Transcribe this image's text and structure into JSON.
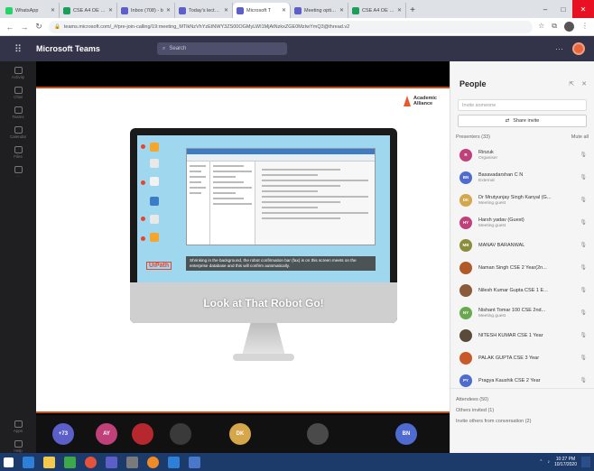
{
  "browser": {
    "tabs": [
      {
        "label": "WhatsApp",
        "fav_color": "#25d366",
        "active": false
      },
      {
        "label": "CSE A4 OE Rec",
        "fav_color": "#1a9e5a",
        "active": false
      },
      {
        "label": "Inbox (708) - b",
        "fav_color": "#5b5fc7",
        "active": false
      },
      {
        "label": "Today's lecture",
        "fav_color": "#5b5fc7",
        "active": false
      },
      {
        "label": "Microsoft T",
        "fav_color": "#5b5fc7",
        "active": true
      },
      {
        "label": "Meeting options",
        "fav_color": "#5b5fc7",
        "active": false
      },
      {
        "label": "CSE A4 OE Rec",
        "fav_color": "#1a9e5a",
        "active": false
      }
    ],
    "new_tab": "+",
    "url": "teams.microsoft.com/_#/pre-join-calling/19:meeting_MTlkNzVhYzEtNWY3ZS00OGMyLWI1MjAtNzkxZGE0MzIwYmQ3@thread.v2",
    "window_controls": {
      "minimize": "–",
      "maximize": "□",
      "close": "✕"
    }
  },
  "teams": {
    "app_name": "Microsoft Teams",
    "search_placeholder": "Search",
    "more": "···"
  },
  "rail": {
    "items": [
      {
        "label": "Activity",
        "icon": "bell-icon"
      },
      {
        "label": "Chat",
        "icon": "chat-icon"
      },
      {
        "label": "Teams",
        "icon": "teams-icon"
      },
      {
        "label": "Calendar",
        "icon": "calendar-icon"
      },
      {
        "label": "Files",
        "icon": "file-icon"
      },
      {
        "label": "···",
        "icon": "more-icon"
      }
    ],
    "bottom": [
      {
        "label": "Apps",
        "icon": "apps-icon"
      },
      {
        "label": "Help",
        "icon": "help-icon"
      }
    ]
  },
  "share": {
    "logo_line1": "Academic",
    "logo_line2": "Alliance",
    "subtitle": "Shrinking in the background, the robot confirmation bar (fax) is on this screen meets on the enterprise database and this will confirm automatically.",
    "brand": "UiPath",
    "caption": "Look at That Robot Go!"
  },
  "strip": {
    "participants": [
      {
        "initials": "+73",
        "color": "#5b5fc7"
      },
      {
        "initials": "AY",
        "color": "#c0407a"
      },
      {
        "initials": "",
        "color": "#b7282e"
      },
      {
        "initials": "",
        "color": "#3a3a3a"
      },
      {
        "initials": "DK",
        "color": "#d5a64a"
      },
      {
        "initials": "",
        "color": "#4a4a4a"
      },
      {
        "initials": "BN",
        "color": "#4f6bd0"
      }
    ]
  },
  "people": {
    "title": "People",
    "invite_placeholder": "Invite someone",
    "share_invite": "Share invite",
    "presenters_label": "Presenters (33)",
    "mute_all": "Mute all",
    "list": [
      {
        "initials": "R",
        "name": "Rinzuk",
        "role": "Organiser",
        "color": "#c0407a"
      },
      {
        "initials": "BN",
        "name": "Basavadarshan C N",
        "role": "External",
        "color": "#4f6bd0"
      },
      {
        "initials": "DK",
        "name": "Dr Mrutyunjay Singh Kanyal (G...",
        "role": "Meeting guest",
        "color": "#d5a64a"
      },
      {
        "initials": "HY",
        "name": "Harsh yadav (Guest)",
        "role": "Meeting guest",
        "color": "#c0407a"
      },
      {
        "initials": "MB",
        "name": "MANAV BARANWAL",
        "role": "",
        "color": "#8b8d3a"
      },
      {
        "initials": "",
        "name": "Naman Singh CSE 2 Year(2n...",
        "role": "",
        "color": "#b05a2a"
      },
      {
        "initials": "",
        "name": "Nilesh Kumar Gupta CSE 1 E...",
        "role": "",
        "color": "#8a5a3a"
      },
      {
        "initials": "NY",
        "name": "Nishant Tomar 100 CSE 2nd...",
        "role": "Meeting guest",
        "color": "#6aa84f"
      },
      {
        "initials": "",
        "name": "NITESH KUMAR CSE 1 Year",
        "role": "",
        "color": "#5a4a3a"
      },
      {
        "initials": "",
        "name": "PALAK GUPTA CSE 3 Year",
        "role": "",
        "color": "#c85a2a"
      },
      {
        "initials": "PY",
        "name": "Pragya Kaushik CSE 2 Year",
        "role": "",
        "color": "#4f6bd0"
      }
    ],
    "attendees": "Attendees (50)",
    "others_invited": "Others invited (1)",
    "suggestions": "Invite others from conversation (2)"
  },
  "taskbar": {
    "clock_time": "10:27 PM",
    "clock_date": "10/17/2020"
  }
}
